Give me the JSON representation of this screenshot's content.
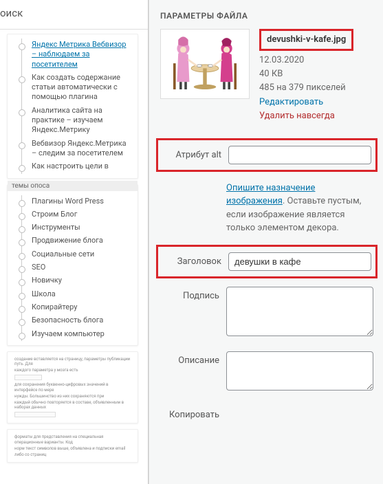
{
  "left": {
    "search_label": "оиск",
    "card1_items": [
      {
        "text": "Яндекс Метрика Вебвизор – наблюдаем за посетителем",
        "link": true
      },
      {
        "text": "Как создать содержание статьи автоматически с помощью плагина",
        "link": false
      },
      {
        "text": "Аналитика сайта на практике – изучаем Яндекс.Метрику",
        "link": false
      },
      {
        "text": "Вебвизор Яндекс.Метрика – следим за посетителем",
        "link": false
      },
      {
        "text": "Как настроить цели в",
        "link": false
      }
    ],
    "card2_title": "темы опоса",
    "card2_items": [
      "Плагины Word Press",
      "Строим Блог",
      "Инструменты",
      "Продвижение блога",
      "Социальные сети",
      "SEO",
      "Новичку",
      "Школа",
      "Копирайтеру",
      "Безопасность блога",
      "Изучаем компьютер"
    ]
  },
  "panel": {
    "title": "ПАРАМЕТРЫ ФАЙЛА",
    "filename": "devushki-v-kafe.jpg",
    "date": "12.03.2020",
    "size": "40 КВ",
    "dimensions": "485 на 379 пикселей",
    "edit_link": "Редактировать",
    "delete_link": "Удалить навсегда",
    "alt_label": "Атрибут alt",
    "alt_value": "",
    "alt_help_link": "Опишите назначение изображения",
    "alt_help_rest": ". Оставьте пустым, если изображение является только элементом декора.",
    "title_label": "Заголовок",
    "title_value": "девушки в кафе",
    "caption_label": "Подпись",
    "caption_value": "",
    "desc_label": "Описание",
    "desc_value": "",
    "copy_label": "Копировать"
  }
}
